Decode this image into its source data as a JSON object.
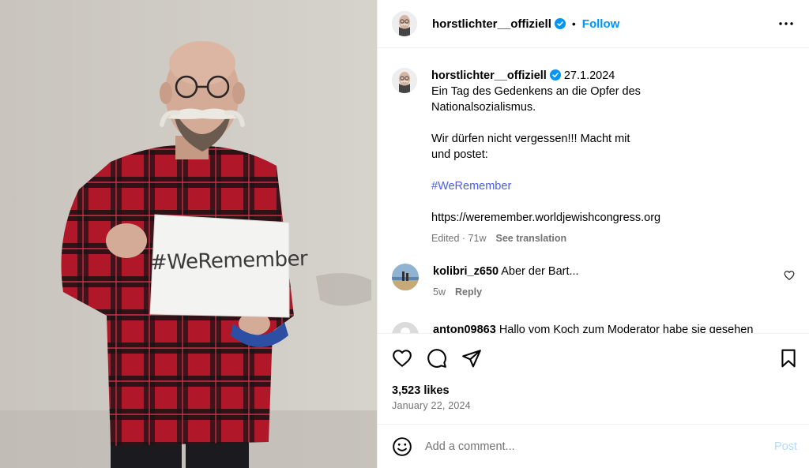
{
  "photo": {
    "sign_text": "#WeRemember"
  },
  "header": {
    "username": "horstlichter__offiziell",
    "separator": "•",
    "follow_label": "Follow",
    "more_icon": "more-horizontal-icon"
  },
  "caption": {
    "username": "horstlichter__offiziell",
    "date": "27.1.2024",
    "line1": "Ein Tag des Gedenkens an die Opfer des",
    "line2": "Nationalsozialismus.",
    "line3": "Wir dürfen nicht vergessen!!! Macht mit",
    "line4": "und postet:",
    "hashtag": "#WeRemember",
    "link": "https://weremember.worldjewishcongress.org",
    "edited": "Edited · 71w",
    "see_translation": "See translation"
  },
  "comments": [
    {
      "username": "kolibri_z650",
      "text": "Aber der Bart...",
      "time": "5w",
      "reply_label": "Reply"
    },
    {
      "username": "anton09863",
      "text": "Hallo vom Koch zum Moderator habe sie gesehen"
    }
  ],
  "actions": {
    "like_icon": "heart-icon",
    "comment_icon": "comment-icon",
    "share_icon": "share-icon",
    "save_icon": "bookmark-icon"
  },
  "likes": "3,523 likes",
  "post_date": "January 22, 2024",
  "add_comment": {
    "placeholder": "Add a comment...",
    "post_label": "Post",
    "emoji_icon": "emoji-icon"
  },
  "colors": {
    "accent": "#0095f6",
    "muted": "#737373",
    "hashtag": "#4a5de5",
    "post_disabled": "#b3dbff"
  }
}
